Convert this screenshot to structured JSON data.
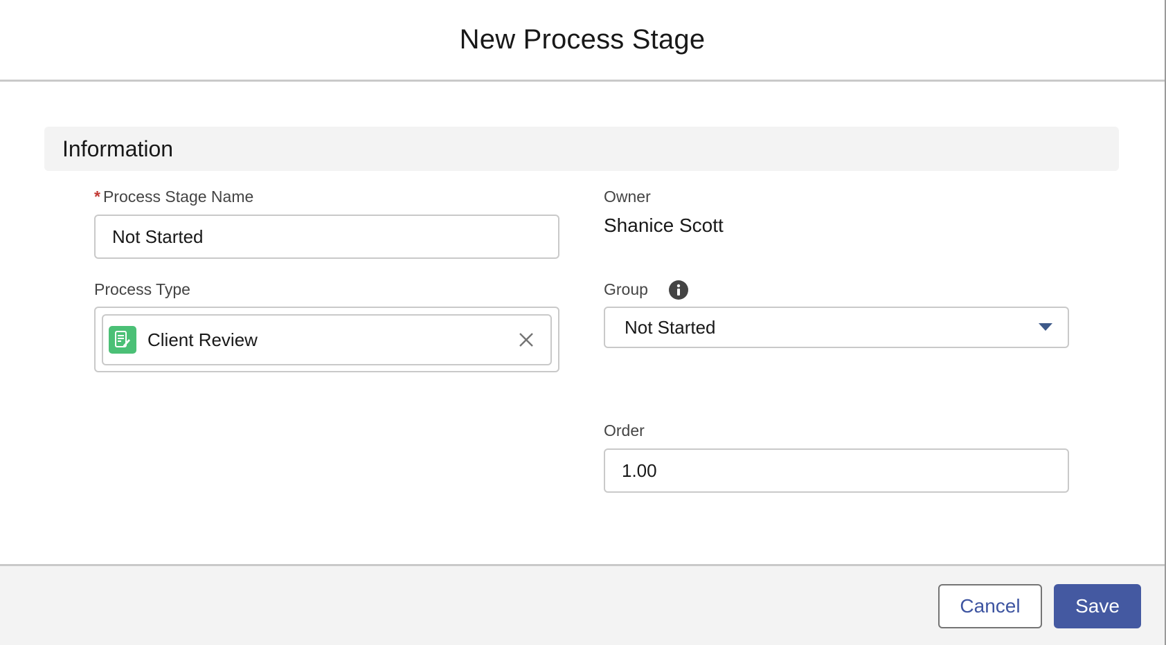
{
  "modal": {
    "title": "New Process Stage"
  },
  "section": {
    "title": "Information"
  },
  "fields": {
    "process_stage_name": {
      "required_marker": "*",
      "label": "Process Stage Name",
      "value": "Not Started"
    },
    "owner": {
      "label": "Owner",
      "value": "Shanice Scott"
    },
    "process_type": {
      "label": "Process Type",
      "selected_record": "Client Review",
      "record_icon": "document-edit-icon",
      "icon_color": "#4bc076"
    },
    "group": {
      "label": "Group",
      "info_icon": "info-icon",
      "selected": "Not Started"
    },
    "order": {
      "label": "Order",
      "value": "1.00"
    }
  },
  "footer": {
    "cancel_label": "Cancel",
    "save_label": "Save"
  },
  "colors": {
    "brand": "#4459a1",
    "required": "#c23934",
    "section_bg": "#f3f3f3"
  }
}
